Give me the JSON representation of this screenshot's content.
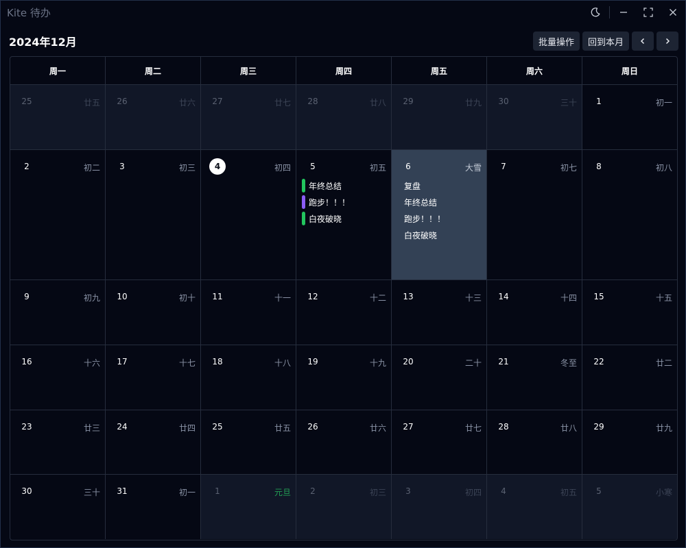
{
  "window": {
    "title": "Kite 待办"
  },
  "toolbar": {
    "month_title": "2024年12月",
    "batch_label": "批量操作",
    "today_label": "回到本月"
  },
  "weekdays": [
    "周一",
    "周二",
    "周三",
    "周四",
    "周五",
    "周六",
    "周日"
  ],
  "colors": {
    "green": "#22c55e",
    "purple": "#8b5cf6",
    "selected": "#334155"
  },
  "days": [
    {
      "day": "25",
      "lunar": "廿五",
      "other": true
    },
    {
      "day": "26",
      "lunar": "廿六",
      "other": true
    },
    {
      "day": "27",
      "lunar": "廿七",
      "other": true
    },
    {
      "day": "28",
      "lunar": "廿八",
      "other": true
    },
    {
      "day": "29",
      "lunar": "廿九",
      "other": true
    },
    {
      "day": "30",
      "lunar": "三十",
      "other": true
    },
    {
      "day": "1",
      "lunar": "初一"
    },
    {
      "day": "2",
      "lunar": "初二"
    },
    {
      "day": "3",
      "lunar": "初三"
    },
    {
      "day": "4",
      "lunar": "初四",
      "today": true
    },
    {
      "day": "5",
      "lunar": "初五",
      "events": [
        {
          "title": "年终总结",
          "color": "#22c55e"
        },
        {
          "title": "跑步！！！",
          "color": "#8b5cf6"
        },
        {
          "title": "白夜破晓",
          "color": "#22c55e"
        }
      ]
    },
    {
      "day": "6",
      "lunar": "大雪",
      "selected": true,
      "events": [
        {
          "title": "复盘"
        },
        {
          "title": "年终总结"
        },
        {
          "title": "跑步！！！"
        },
        {
          "title": "白夜破晓"
        }
      ]
    },
    {
      "day": "7",
      "lunar": "初七"
    },
    {
      "day": "8",
      "lunar": "初八"
    },
    {
      "day": "9",
      "lunar": "初九"
    },
    {
      "day": "10",
      "lunar": "初十"
    },
    {
      "day": "11",
      "lunar": "十一"
    },
    {
      "day": "12",
      "lunar": "十二"
    },
    {
      "day": "13",
      "lunar": "十三"
    },
    {
      "day": "14",
      "lunar": "十四"
    },
    {
      "day": "15",
      "lunar": "十五"
    },
    {
      "day": "16",
      "lunar": "十六"
    },
    {
      "day": "17",
      "lunar": "十七"
    },
    {
      "day": "18",
      "lunar": "十八"
    },
    {
      "day": "19",
      "lunar": "十九"
    },
    {
      "day": "20",
      "lunar": "二十"
    },
    {
      "day": "21",
      "lunar": "冬至"
    },
    {
      "day": "22",
      "lunar": "廿二"
    },
    {
      "day": "23",
      "lunar": "廿三"
    },
    {
      "day": "24",
      "lunar": "廿四"
    },
    {
      "day": "25",
      "lunar": "廿五"
    },
    {
      "day": "26",
      "lunar": "廿六"
    },
    {
      "day": "27",
      "lunar": "廿七"
    },
    {
      "day": "28",
      "lunar": "廿八"
    },
    {
      "day": "29",
      "lunar": "廿九"
    },
    {
      "day": "30",
      "lunar": "三十"
    },
    {
      "day": "31",
      "lunar": "初一"
    },
    {
      "day": "1",
      "lunar": "元旦",
      "other": true,
      "holiday": true
    },
    {
      "day": "2",
      "lunar": "初三",
      "other": true
    },
    {
      "day": "3",
      "lunar": "初四",
      "other": true
    },
    {
      "day": "4",
      "lunar": "初五",
      "other": true
    },
    {
      "day": "5",
      "lunar": "小寒",
      "other": true
    }
  ]
}
